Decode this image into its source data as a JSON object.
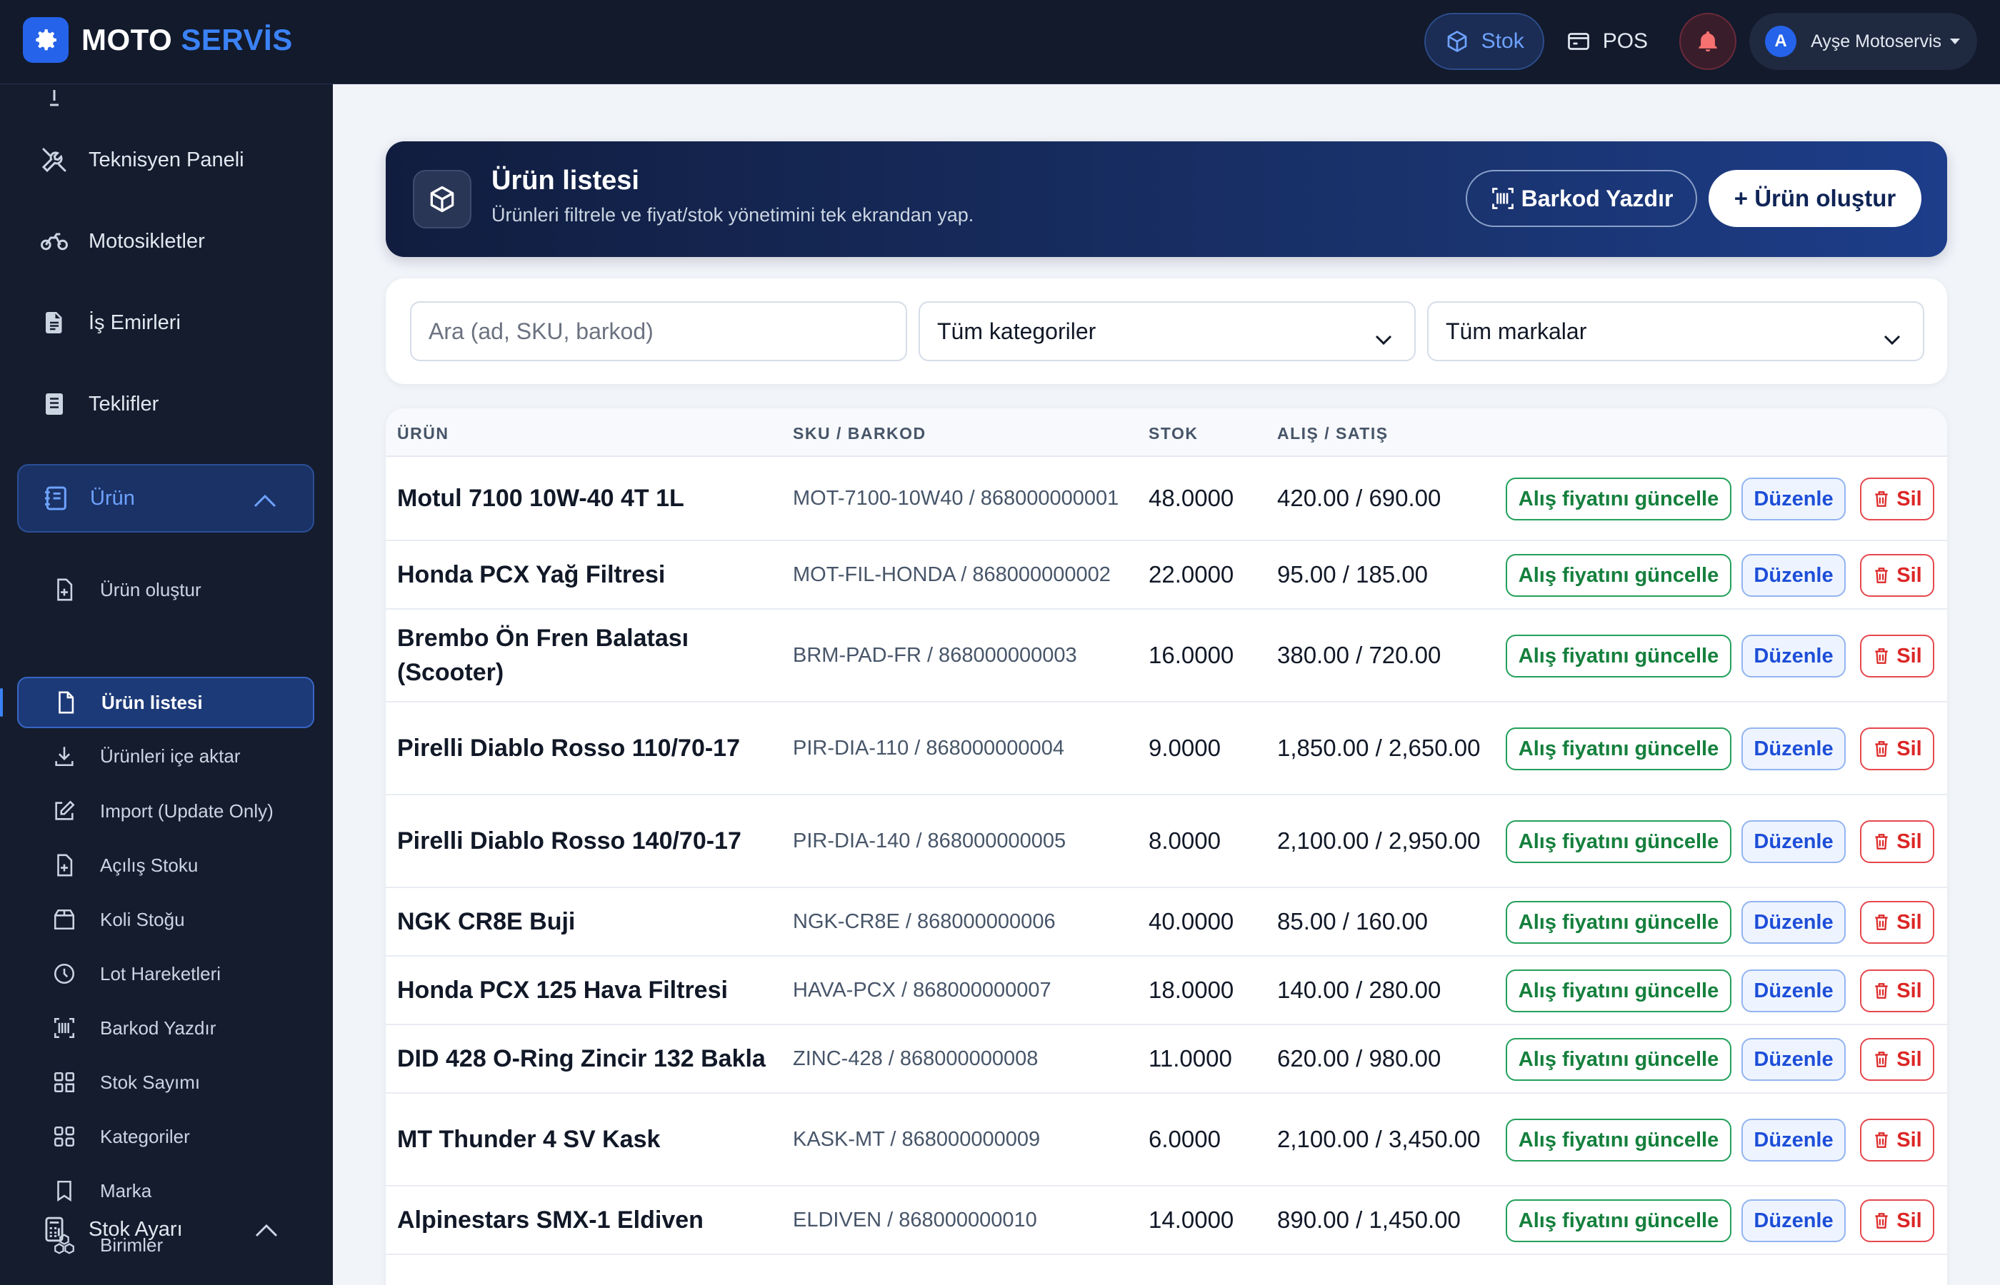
{
  "app": {
    "brand_main": "MOTO",
    "brand_accent": "SERVİS"
  },
  "topbar": {
    "stok": "Stok",
    "pos": "POS",
    "user": "Ayşe Motoservis",
    "avatar_letter": "A"
  },
  "sidebar": {
    "nav": [
      "Teknisyen Paneli",
      "Motosikletler",
      "İş Emirleri",
      "Teklifler"
    ],
    "urun_group": "Ürün",
    "urun_items": [
      "Ürün oluştur",
      "Ürün listesi",
      "Ürünleri içe aktar",
      "Import (Update Only)",
      "Açılış Stoku",
      "Koli Stoğu",
      "Lot Hareketleri",
      "Barkod Yazdır",
      "Stok Sayımı",
      "Kategoriler",
      "Marka",
      "Birimler"
    ],
    "stok_group": "Stok Ayarı"
  },
  "header": {
    "title": "Ürün listesi",
    "subtitle": "Ürünleri filtrele ve fiyat/stok yönetimini tek ekrandan yap.",
    "barcode_button": "Barkod Yazdır",
    "create_button": "+ Ürün oluştur"
  },
  "filters": {
    "search_placeholder": "Ara (ad, SKU, barkod)",
    "category_selected": "Tüm kategoriler",
    "brand_selected": "Tüm markalar"
  },
  "table": {
    "columns": [
      "ÜRÜN",
      "SKU / BARKOD",
      "STOK",
      "ALIŞ / SATIŞ"
    ],
    "actions": {
      "buy": "Alış fiyatını güncelle",
      "edit": "Düzenle",
      "delete": "Sil"
    },
    "rows": [
      {
        "name": "Motul 7100 10W-40 4T 1L",
        "sku": "MOT-7100-10W40 / 868000000001",
        "stock": "48.0000",
        "price": "420.00 / 690.00"
      },
      {
        "name": "Honda PCX Yağ Filtresi",
        "sku": "MOT-FIL-HONDA / 868000000002",
        "stock": "22.0000",
        "price": "95.00 / 185.00"
      },
      {
        "name": "Brembo Ön Fren Balatası (Scooter)",
        "sku": "BRM-PAD-FR / 868000000003",
        "stock": "16.0000",
        "price": "380.00 / 720.00"
      },
      {
        "name": "Pirelli Diablo Rosso 110/70-17",
        "sku": "PIR-DIA-110 / 868000000004",
        "stock": "9.0000",
        "price": "1,850.00 / 2,650.00"
      },
      {
        "name": "Pirelli Diablo Rosso 140/70-17",
        "sku": "PIR-DIA-140 / 868000000005",
        "stock": "8.0000",
        "price": "2,100.00 / 2,950.00"
      },
      {
        "name": "NGK CR8E Buji",
        "sku": "NGK-CR8E / 868000000006",
        "stock": "40.0000",
        "price": "85.00 / 160.00"
      },
      {
        "name": "Honda PCX 125 Hava Filtresi",
        "sku": "HAVA-PCX / 868000000007",
        "stock": "18.0000",
        "price": "140.00 / 280.00"
      },
      {
        "name": "DID 428 O-Ring Zincir 132 Bakla",
        "sku": "ZINC-428 / 868000000008",
        "stock": "11.0000",
        "price": "620.00 / 980.00"
      },
      {
        "name": "MT Thunder 4 SV Kask",
        "sku": "KASK-MT / 868000000009",
        "stock": "6.0000",
        "price": "2,100.00 / 3,450.00"
      },
      {
        "name": "Alpinestars SMX-1 Eldiven",
        "sku": "ELDIVEN / 868000000010",
        "stock": "14.0000",
        "price": "890.00 / 1,450.00"
      }
    ]
  }
}
